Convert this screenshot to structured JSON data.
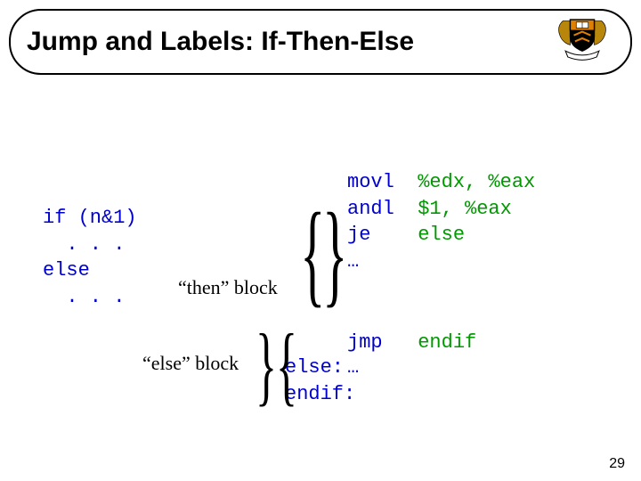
{
  "title": "Jump and Labels: If-Then-Else",
  "page_number": "29",
  "c_code": {
    "line1": "if (n&1)",
    "line2": "  . . .",
    "line3": "else",
    "line4": "  . . ."
  },
  "asm_top": {
    "l1_op": "movl",
    "l1_arg": "%edx, %eax",
    "l2_op": "andl",
    "l2_arg": "$1, %eax",
    "l3_op": "je",
    "l3_arg": "else",
    "l4_op": "…",
    "l4_arg": ""
  },
  "asm_bottom": {
    "l1_op": "jmp",
    "l1_arg": "endif",
    "label_else": "else:",
    "l2_op": "…",
    "label_endif": "endif:"
  },
  "annotations": {
    "then_block": "“then” block",
    "else_block": "“else” block"
  }
}
